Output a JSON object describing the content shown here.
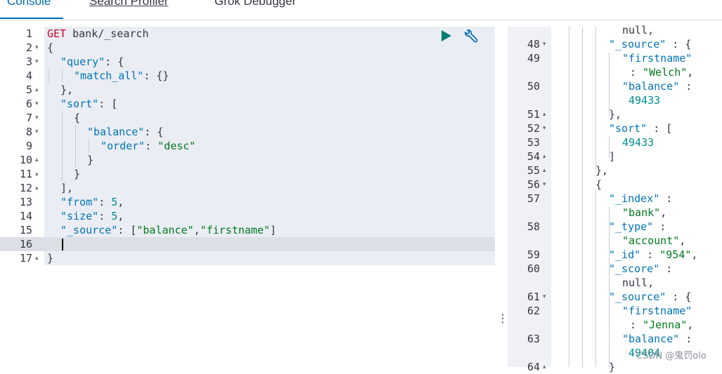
{
  "tabs": [
    {
      "label": "Console",
      "active": true
    },
    {
      "label": "Search Profiler",
      "active": false
    },
    {
      "label": "Grok Debugger",
      "active": false
    }
  ],
  "editor": {
    "lines": [
      {
        "num": "1",
        "fold": ""
      },
      {
        "num": "2",
        "fold": "▾"
      },
      {
        "num": "3",
        "fold": "▾"
      },
      {
        "num": "4",
        "fold": ""
      },
      {
        "num": "5",
        "fold": "▴"
      },
      {
        "num": "6",
        "fold": "▾"
      },
      {
        "num": "7",
        "fold": "▾"
      },
      {
        "num": "8",
        "fold": "▾"
      },
      {
        "num": "9",
        "fold": ""
      },
      {
        "num": "10",
        "fold": "▴"
      },
      {
        "num": "11",
        "fold": "▴"
      },
      {
        "num": "12",
        "fold": "▴"
      },
      {
        "num": "13",
        "fold": ""
      },
      {
        "num": "14",
        "fold": ""
      },
      {
        "num": "15",
        "fold": ""
      },
      {
        "num": "16",
        "fold": ""
      },
      {
        "num": "17",
        "fold": "▴"
      }
    ],
    "code": {
      "l1_method": "GET",
      "l1_path": " bank/_search",
      "l2": "{",
      "l3_key": "\"query\"",
      "l3_rest": ": {",
      "l4_key": "\"match_all\"",
      "l4_rest": ": {}",
      "l5": "},",
      "l6_key": "\"sort\"",
      "l6_rest": ": [",
      "l7": "{",
      "l8_key": "\"balance\"",
      "l8_rest": ": {",
      "l9_key": "\"order\"",
      "l9_colon": ": ",
      "l9_val": "\"desc\"",
      "l10": "}",
      "l11": "}",
      "l12": "],",
      "l13_key": "\"from\"",
      "l13_colon": ": ",
      "l13_val": "5",
      "l13_end": ",",
      "l14_key": "\"size\"",
      "l14_colon": ": ",
      "l14_val": "5",
      "l14_end": ",",
      "l15_key": "\"_source\"",
      "l15_colon": ": [",
      "l15_v1": "\"balance\"",
      "l15_comma": ",",
      "l15_v2": "\"firstname\"",
      "l15_end": "]",
      "l17": "}"
    }
  },
  "output": {
    "lines": [
      {
        "num": "",
        "fold": ""
      },
      {
        "num": "48",
        "fold": "▾"
      },
      {
        "num": "49",
        "fold": ""
      },
      {
        "num": "",
        "fold": ""
      },
      {
        "num": "50",
        "fold": ""
      },
      {
        "num": "",
        "fold": ""
      },
      {
        "num": "51",
        "fold": "▴"
      },
      {
        "num": "52",
        "fold": "▾"
      },
      {
        "num": "53",
        "fold": ""
      },
      {
        "num": "54",
        "fold": "▴"
      },
      {
        "num": "55",
        "fold": "▴"
      },
      {
        "num": "56",
        "fold": "▾"
      },
      {
        "num": "57",
        "fold": ""
      },
      {
        "num": "",
        "fold": ""
      },
      {
        "num": "58",
        "fold": ""
      },
      {
        "num": "",
        "fold": ""
      },
      {
        "num": "59",
        "fold": ""
      },
      {
        "num": "60",
        "fold": ""
      },
      {
        "num": "",
        "fold": ""
      },
      {
        "num": "61",
        "fold": "▾"
      },
      {
        "num": "62",
        "fold": ""
      },
      {
        "num": "",
        "fold": ""
      },
      {
        "num": "63",
        "fold": ""
      },
      {
        "num": "",
        "fold": ""
      },
      {
        "num": "64",
        "fold": "▴"
      }
    ],
    "code": {
      "r0": "null,",
      "r1_key": "\"_source\"",
      "r1_rest": " : {",
      "r2_key": "\"firstname\"",
      "r3_colon": ": ",
      "r3_val": "\"Welch\"",
      "r3_end": ",",
      "r4_key": "\"balance\"",
      "r4_rest": " :",
      "r5_val": "49433",
      "r6": "},",
      "r7_key": "\"sort\"",
      "r7_rest": " : [",
      "r8_val": "49433",
      "r9": "]",
      "r10": "},",
      "r11": "{",
      "r12_key": "\"_index\"",
      "r12_rest": " :",
      "r13_val": "\"bank\"",
      "r13_end": ",",
      "r14_key": "\"_type\"",
      "r14_rest": " :",
      "r15_val": "\"account\"",
      "r15_end": ",",
      "r16_key": "\"_id\"",
      "r16_colon": " : ",
      "r16_val": "\"954\"",
      "r16_end": ",",
      "r17_key": "\"_score\"",
      "r17_rest": " :",
      "r18": "null,",
      "r19_key": "\"_source\"",
      "r19_rest": " : {",
      "r20_key": "\"firstname\"",
      "r21_colon": ": ",
      "r21_val": "\"Jenna\"",
      "r21_end": ",",
      "r22_key": "\"balance\"",
      "r22_rest": " :",
      "r23_val": "49404",
      "r24": "}"
    }
  },
  "icons": {
    "run": "play-icon",
    "settings": "wrench-icon",
    "resize": "drag-handle-icon"
  },
  "watermark": "CSDN @鬼罚olo"
}
